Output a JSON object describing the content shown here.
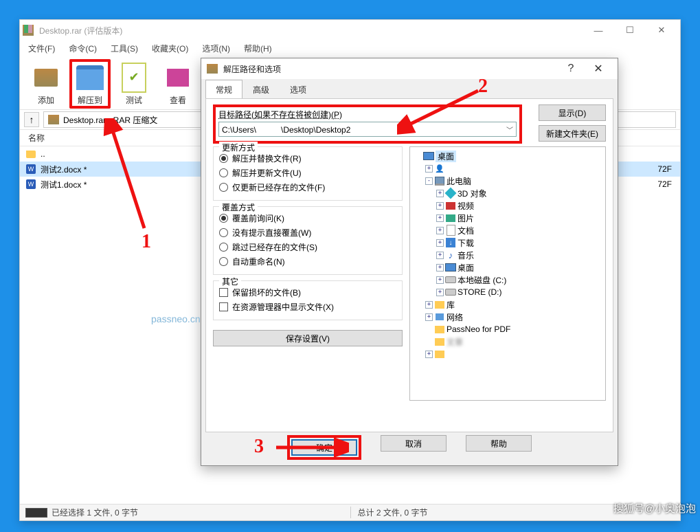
{
  "main": {
    "title": "Desktop.rar (评估版本)",
    "menu": [
      "文件(F)",
      "命令(C)",
      "工具(S)",
      "收藏夹(O)",
      "选项(N)",
      "帮助(H)"
    ],
    "toolbar": {
      "add": "添加",
      "extract": "解压到",
      "test": "测试",
      "view": "查看"
    },
    "address": "Desktop.rar - RAR 压缩文",
    "col_name": "名称",
    "files": [
      "..",
      "测试2.docx *",
      "测试1.docx *"
    ],
    "size_visible": "72F",
    "status_left": "已经选择 1 文件, 0 字节",
    "status_right": "总计 2 文件, 0 字节"
  },
  "dlg": {
    "title": "解压路径和选项",
    "tabs": [
      "常规",
      "高级",
      "选项"
    ],
    "path_label": "目标路径(如果不存在将被创建)(P)",
    "path_value": "C:\\Users\\　　　\\Desktop\\Desktop2",
    "btn_show": "显示(D)",
    "btn_newfolder": "新建文件夹(E)",
    "grp_update": "更新方式",
    "update_opts": [
      "解压并替换文件(R)",
      "解压并更新文件(U)",
      "仅更新已经存在的文件(F)"
    ],
    "update_sel": 0,
    "grp_overwrite": "覆盖方式",
    "overwrite_opts": [
      "覆盖前询问(K)",
      "没有提示直接覆盖(W)",
      "跳过已经存在的文件(S)",
      "自动重命名(N)"
    ],
    "overwrite_sel": 0,
    "grp_other": "其它",
    "other_opts": [
      "保留损坏的文件(B)",
      "在资源管理器中显示文件(X)"
    ],
    "btn_save": "保存设置(V)",
    "btn_ok": "确定",
    "btn_cancel": "取消",
    "btn_help": "帮助",
    "tree": [
      {
        "pad": 0,
        "exp": "none",
        "icon": "desktop",
        "label": "桌面",
        "sel": true
      },
      {
        "pad": 1,
        "exp": "plus",
        "icon": "user",
        "label": "　　　",
        "ob": true
      },
      {
        "pad": 1,
        "exp": "minus",
        "icon": "pc",
        "label": "此电脑"
      },
      {
        "pad": 2,
        "exp": "plus",
        "icon": "obj3d",
        "label": "3D 对象"
      },
      {
        "pad": 2,
        "exp": "plus",
        "icon": "video",
        "label": "视频"
      },
      {
        "pad": 2,
        "exp": "plus",
        "icon": "pic",
        "label": "图片"
      },
      {
        "pad": 2,
        "exp": "plus",
        "icon": "doc",
        "label": "文档"
      },
      {
        "pad": 2,
        "exp": "plus",
        "icon": "down",
        "label": "下载"
      },
      {
        "pad": 2,
        "exp": "plus",
        "icon": "music",
        "label": "音乐"
      },
      {
        "pad": 2,
        "exp": "plus",
        "icon": "desktop",
        "label": "桌面"
      },
      {
        "pad": 2,
        "exp": "plus",
        "icon": "disk",
        "label": "本地磁盘 (C:)"
      },
      {
        "pad": 2,
        "exp": "plus",
        "icon": "disk",
        "label": "STORE (D:)"
      },
      {
        "pad": 1,
        "exp": "plus",
        "icon": "folder",
        "label": "库"
      },
      {
        "pad": 1,
        "exp": "plus",
        "icon": "net",
        "label": "网络"
      },
      {
        "pad": 1,
        "exp": "none",
        "icon": "folder",
        "label": "PassNeo for PDF"
      },
      {
        "pad": 1,
        "exp": "none",
        "icon": "folder",
        "label": "文章",
        "ob": true
      },
      {
        "pad": 1,
        "exp": "plus",
        "icon": "folder",
        "label": "　　　　",
        "ob": true
      }
    ]
  },
  "anno": {
    "l1": "1",
    "l2": "2",
    "l3": "3"
  },
  "watermark": "passneo.cn",
  "credit": "搜狐号@小奥泡泡"
}
